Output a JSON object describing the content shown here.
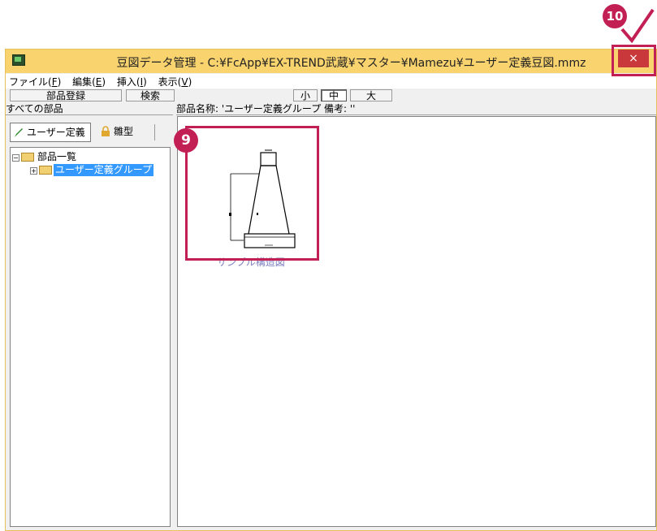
{
  "window": {
    "title": "豆図データ管理 - C:¥FcApp¥EX-TREND武蔵¥マスター¥Mamezu¥ユーザー定義豆図.mmz",
    "close_symbol": "×"
  },
  "menu": [
    {
      "label": "ファイル(",
      "key": "F",
      "tail": ")"
    },
    {
      "label": "編集(",
      "key": "E",
      "tail": ")"
    },
    {
      "label": "挿入(",
      "key": "I",
      "tail": ")"
    },
    {
      "label": "表示(",
      "key": "V",
      "tail": ")"
    }
  ],
  "toolbar": {
    "register_label": "部品登録",
    "search_label": "検索",
    "size_small": "小",
    "size_medium": "中",
    "size_large": "大",
    "active_size": "中"
  },
  "left_panel": {
    "header": "すべての部品",
    "tabs": [
      "ユーザー定義",
      "雛型"
    ],
    "active_tab": "ユーザー定義",
    "tree": {
      "root_label": "部品一覧",
      "child_label": "ユーザー定義グループ"
    }
  },
  "right_panel": {
    "header": "部品名称: 'ユーザー定義グループ  備考: ''",
    "part_label": "サンプル構造図"
  },
  "callouts": {
    "step9": "9",
    "step10": "10"
  },
  "colors": {
    "titlebar": "#f9d36e",
    "close_button": "#c9383a",
    "highlight": "#c21f55",
    "selection": "#3399ff",
    "part_label": "#7a7fbf"
  }
}
